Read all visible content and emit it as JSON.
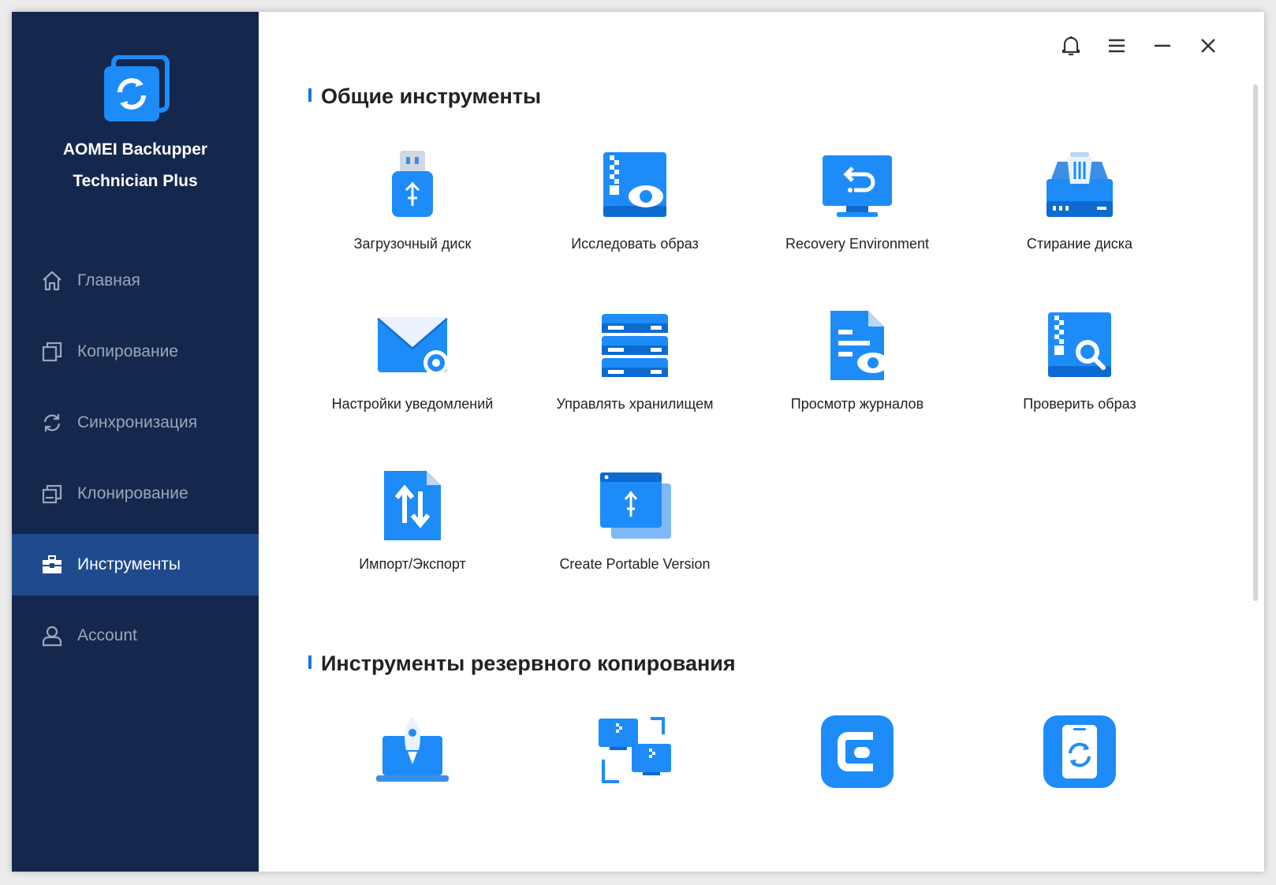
{
  "app": {
    "name": "AOMEI Backupper",
    "edition": "Technician Plus"
  },
  "sidebar": {
    "items": [
      {
        "label": "Главная",
        "icon": "home-icon",
        "active": false
      },
      {
        "label": "Копирование",
        "icon": "backup-icon",
        "active": false
      },
      {
        "label": "Синхронизация",
        "icon": "sync-icon",
        "active": false
      },
      {
        "label": "Клонирование",
        "icon": "clone-icon",
        "active": false
      },
      {
        "label": "Инструменты",
        "icon": "toolbox-icon",
        "active": true
      },
      {
        "label": "Account",
        "icon": "user-icon",
        "active": false
      }
    ]
  },
  "titlebar": {
    "buttons": [
      "bell-icon",
      "menu-icon",
      "minimize-icon",
      "close-icon"
    ]
  },
  "sections": {
    "common": {
      "title": "Общие инструменты",
      "tools": [
        {
          "label": "Загрузочный диск",
          "icon": "usb-drive-icon"
        },
        {
          "label": "Исследовать образ",
          "icon": "explore-image-icon"
        },
        {
          "label": "Recovery Environment",
          "icon": "recovery-monitor-icon"
        },
        {
          "label": "Стирание диска",
          "icon": "disk-wipe-icon"
        },
        {
          "label": "Настройки уведомлений",
          "icon": "mail-settings-icon"
        },
        {
          "label": "Управлять хранилищем",
          "icon": "storage-server-icon"
        },
        {
          "label": "Просмотр журналов",
          "icon": "view-logs-icon"
        },
        {
          "label": "Проверить образ",
          "icon": "check-image-icon"
        },
        {
          "label": "Импорт/Экспорт",
          "icon": "import-export-icon"
        },
        {
          "label": "Create Portable Version",
          "icon": "portable-version-icon"
        }
      ]
    },
    "backup": {
      "title": "Инструменты резервного копирования",
      "tools": [
        {
          "icon": "launch-laptop-icon"
        },
        {
          "icon": "pc-transfer-icon"
        },
        {
          "icon": "cbackup-icon"
        },
        {
          "icon": "phone-sync-icon"
        }
      ]
    }
  },
  "colors": {
    "sidebar": "#14274d",
    "active": "#1f4a8c",
    "accent": "#1a73e8"
  }
}
